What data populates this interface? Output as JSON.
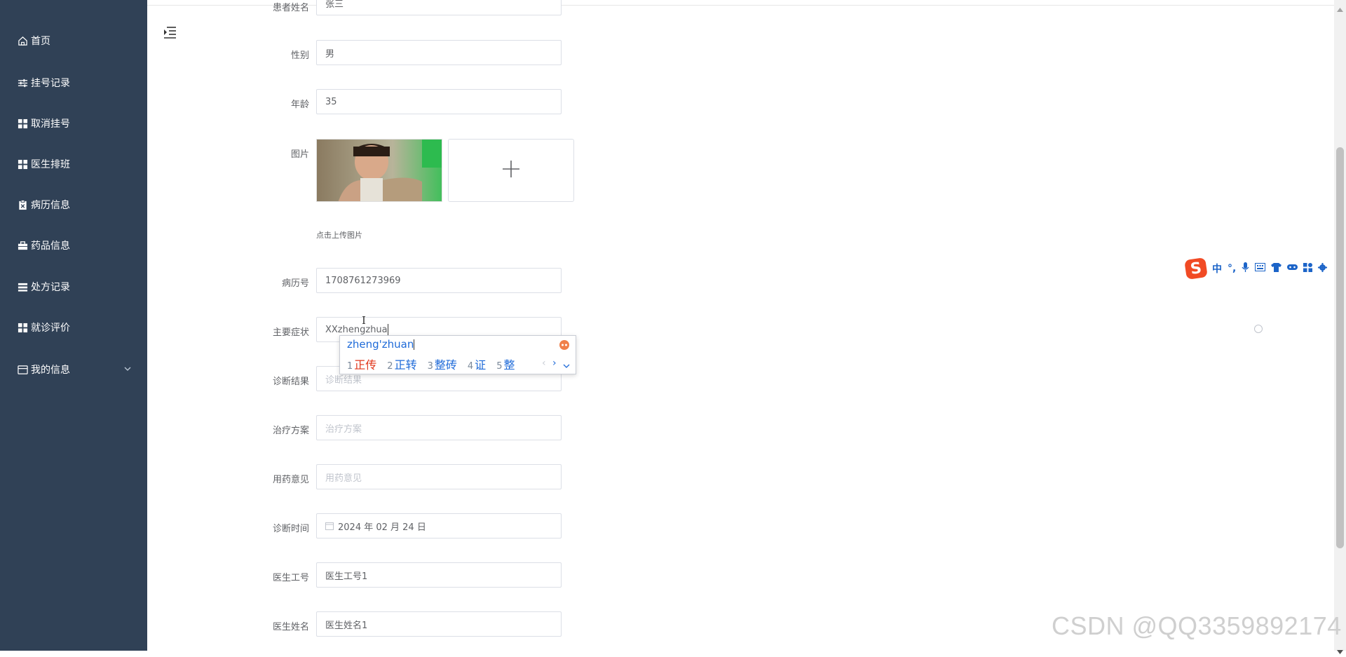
{
  "sidebar": {
    "items": [
      {
        "label": "首页",
        "icon": "home-icon"
      },
      {
        "label": "挂号记录",
        "icon": "sliders-icon"
      },
      {
        "label": "取消挂号",
        "icon": "grid-icon"
      },
      {
        "label": "医生排班",
        "icon": "grid-icon"
      },
      {
        "label": "病历信息",
        "icon": "clipboard-icon"
      },
      {
        "label": "药品信息",
        "icon": "briefcase-icon"
      },
      {
        "label": "处方记录",
        "icon": "list-icon"
      },
      {
        "label": "就诊评价",
        "icon": "grid-icon"
      },
      {
        "label": "我的信息",
        "icon": "card-icon"
      }
    ]
  },
  "form": {
    "patient_name_label": "患者姓名",
    "patient_name_value": "张三",
    "gender_label": "性别",
    "gender_value": "男",
    "age_label": "年龄",
    "age_value": "35",
    "image_label": "图片",
    "upload_tip": "点击上传图片",
    "record_no_label": "病历号",
    "record_no_value": "1708761273969",
    "symptom_label": "主要症状",
    "symptom_value": "XXzhengzhua",
    "diagnosis_label": "诊断结果",
    "diagnosis_placeholder": "诊断结果",
    "treatment_label": "治疗方案",
    "treatment_placeholder": "治疗方案",
    "medication_label": "用药意见",
    "medication_placeholder": "用药意见",
    "diag_time_label": "诊断时间",
    "diag_time_value": "2024 年 02 月 24 日",
    "doctor_id_label": "医生工号",
    "doctor_id_value": "医生工号1",
    "doctor_name_label": "医生姓名",
    "doctor_name_value": "医生姓名1"
  },
  "ime": {
    "pinyin": "zheng'zhuan",
    "candidates": [
      {
        "n": "1",
        "text": "正传"
      },
      {
        "n": "2",
        "text": "正转"
      },
      {
        "n": "3",
        "text": "整砖"
      },
      {
        "n": "4",
        "text": "证"
      },
      {
        "n": "5",
        "text": "整"
      }
    ],
    "toolbar_logo": "S",
    "toolbar_lang": "中"
  },
  "watermark": "CSDN @QQ3359892174",
  "colors": {
    "sidebar": "#304156",
    "ime_blue": "#1e6ad8",
    "ime_first": "#e0351a",
    "logo": "#f14a24"
  }
}
